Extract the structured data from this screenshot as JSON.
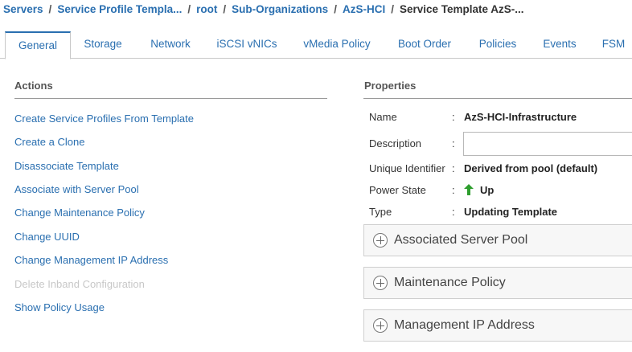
{
  "breadcrumb": {
    "items": [
      "Servers",
      "Service Profile Templa...",
      "root",
      "Sub-Organizations",
      "AzS-HCI",
      "Service Template AzS-..."
    ],
    "separator": "/"
  },
  "tabs": [
    {
      "label": "General",
      "active": true
    },
    {
      "label": "Storage"
    },
    {
      "label": "Network"
    },
    {
      "label": "iSCSI vNICs"
    },
    {
      "label": "vMedia Policy"
    },
    {
      "label": "Boot Order"
    },
    {
      "label": "Policies"
    },
    {
      "label": "Events"
    },
    {
      "label": "FSM"
    }
  ],
  "actions": {
    "title": "Actions",
    "items": [
      {
        "label": "Create Service Profiles From Template"
      },
      {
        "label": "Create a Clone"
      },
      {
        "label": "Disassociate Template"
      },
      {
        "label": "Associate with Server Pool"
      },
      {
        "label": "Change Maintenance Policy"
      },
      {
        "label": "Change UUID"
      },
      {
        "label": "Change Management IP Address"
      },
      {
        "label": "Delete Inband Configuration",
        "disabled": true
      },
      {
        "label": "Show Policy Usage"
      }
    ]
  },
  "properties": {
    "title": "Properties",
    "colon": ":",
    "name_label": "Name",
    "name_value": "AzS-HCI-Infrastructure",
    "description_label": "Description",
    "description_value": "",
    "uid_label": "Unique Identifier",
    "uid_value": "Derived from pool (default)",
    "power_label": "Power State",
    "power_value": "Up",
    "power_icon": "up-arrow-icon",
    "type_label": "Type",
    "type_value": "Updating Template"
  },
  "panels": [
    {
      "label": "Associated Server Pool"
    },
    {
      "label": "Maintenance Policy"
    },
    {
      "label": "Management IP Address"
    }
  ],
  "colors": {
    "link": "#2a6fb0",
    "disabled": "#c8c8c8",
    "up_arrow": "#2e9e2e"
  }
}
